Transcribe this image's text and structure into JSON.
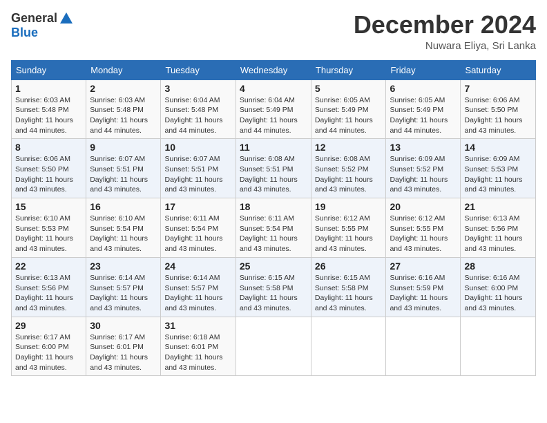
{
  "header": {
    "logo_general": "General",
    "logo_blue": "Blue",
    "month": "December 2024",
    "location": "Nuwara Eliya, Sri Lanka"
  },
  "calendar": {
    "columns": [
      "Sunday",
      "Monday",
      "Tuesday",
      "Wednesday",
      "Thursday",
      "Friday",
      "Saturday"
    ],
    "weeks": [
      [
        {
          "day": "",
          "sunrise": "",
          "sunset": "",
          "daylight": ""
        },
        {
          "day": "2",
          "sunrise": "Sunrise: 6:03 AM",
          "sunset": "Sunset: 5:48 PM",
          "daylight": "Daylight: 11 hours and 44 minutes."
        },
        {
          "day": "3",
          "sunrise": "Sunrise: 6:04 AM",
          "sunset": "Sunset: 5:48 PM",
          "daylight": "Daylight: 11 hours and 44 minutes."
        },
        {
          "day": "4",
          "sunrise": "Sunrise: 6:04 AM",
          "sunset": "Sunset: 5:49 PM",
          "daylight": "Daylight: 11 hours and 44 minutes."
        },
        {
          "day": "5",
          "sunrise": "Sunrise: 6:05 AM",
          "sunset": "Sunset: 5:49 PM",
          "daylight": "Daylight: 11 hours and 44 minutes."
        },
        {
          "day": "6",
          "sunrise": "Sunrise: 6:05 AM",
          "sunset": "Sunset: 5:49 PM",
          "daylight": "Daylight: 11 hours and 44 minutes."
        },
        {
          "day": "7",
          "sunrise": "Sunrise: 6:06 AM",
          "sunset": "Sunset: 5:50 PM",
          "daylight": "Daylight: 11 hours and 43 minutes."
        }
      ],
      [
        {
          "day": "8",
          "sunrise": "Sunrise: 6:06 AM",
          "sunset": "Sunset: 5:50 PM",
          "daylight": "Daylight: 11 hours and 43 minutes."
        },
        {
          "day": "9",
          "sunrise": "Sunrise: 6:07 AM",
          "sunset": "Sunset: 5:51 PM",
          "daylight": "Daylight: 11 hours and 43 minutes."
        },
        {
          "day": "10",
          "sunrise": "Sunrise: 6:07 AM",
          "sunset": "Sunset: 5:51 PM",
          "daylight": "Daylight: 11 hours and 43 minutes."
        },
        {
          "day": "11",
          "sunrise": "Sunrise: 6:08 AM",
          "sunset": "Sunset: 5:51 PM",
          "daylight": "Daylight: 11 hours and 43 minutes."
        },
        {
          "day": "12",
          "sunrise": "Sunrise: 6:08 AM",
          "sunset": "Sunset: 5:52 PM",
          "daylight": "Daylight: 11 hours and 43 minutes."
        },
        {
          "day": "13",
          "sunrise": "Sunrise: 6:09 AM",
          "sunset": "Sunset: 5:52 PM",
          "daylight": "Daylight: 11 hours and 43 minutes."
        },
        {
          "day": "14",
          "sunrise": "Sunrise: 6:09 AM",
          "sunset": "Sunset: 5:53 PM",
          "daylight": "Daylight: 11 hours and 43 minutes."
        }
      ],
      [
        {
          "day": "15",
          "sunrise": "Sunrise: 6:10 AM",
          "sunset": "Sunset: 5:53 PM",
          "daylight": "Daylight: 11 hours and 43 minutes."
        },
        {
          "day": "16",
          "sunrise": "Sunrise: 6:10 AM",
          "sunset": "Sunset: 5:54 PM",
          "daylight": "Daylight: 11 hours and 43 minutes."
        },
        {
          "day": "17",
          "sunrise": "Sunrise: 6:11 AM",
          "sunset": "Sunset: 5:54 PM",
          "daylight": "Daylight: 11 hours and 43 minutes."
        },
        {
          "day": "18",
          "sunrise": "Sunrise: 6:11 AM",
          "sunset": "Sunset: 5:54 PM",
          "daylight": "Daylight: 11 hours and 43 minutes."
        },
        {
          "day": "19",
          "sunrise": "Sunrise: 6:12 AM",
          "sunset": "Sunset: 5:55 PM",
          "daylight": "Daylight: 11 hours and 43 minutes."
        },
        {
          "day": "20",
          "sunrise": "Sunrise: 6:12 AM",
          "sunset": "Sunset: 5:55 PM",
          "daylight": "Daylight: 11 hours and 43 minutes."
        },
        {
          "day": "21",
          "sunrise": "Sunrise: 6:13 AM",
          "sunset": "Sunset: 5:56 PM",
          "daylight": "Daylight: 11 hours and 43 minutes."
        }
      ],
      [
        {
          "day": "22",
          "sunrise": "Sunrise: 6:13 AM",
          "sunset": "Sunset: 5:56 PM",
          "daylight": "Daylight: 11 hours and 43 minutes."
        },
        {
          "day": "23",
          "sunrise": "Sunrise: 6:14 AM",
          "sunset": "Sunset: 5:57 PM",
          "daylight": "Daylight: 11 hours and 43 minutes."
        },
        {
          "day": "24",
          "sunrise": "Sunrise: 6:14 AM",
          "sunset": "Sunset: 5:57 PM",
          "daylight": "Daylight: 11 hours and 43 minutes."
        },
        {
          "day": "25",
          "sunrise": "Sunrise: 6:15 AM",
          "sunset": "Sunset: 5:58 PM",
          "daylight": "Daylight: 11 hours and 43 minutes."
        },
        {
          "day": "26",
          "sunrise": "Sunrise: 6:15 AM",
          "sunset": "Sunset: 5:58 PM",
          "daylight": "Daylight: 11 hours and 43 minutes."
        },
        {
          "day": "27",
          "sunrise": "Sunrise: 6:16 AM",
          "sunset": "Sunset: 5:59 PM",
          "daylight": "Daylight: 11 hours and 43 minutes."
        },
        {
          "day": "28",
          "sunrise": "Sunrise: 6:16 AM",
          "sunset": "Sunset: 6:00 PM",
          "daylight": "Daylight: 11 hours and 43 minutes."
        }
      ],
      [
        {
          "day": "29",
          "sunrise": "Sunrise: 6:17 AM",
          "sunset": "Sunset: 6:00 PM",
          "daylight": "Daylight: 11 hours and 43 minutes."
        },
        {
          "day": "30",
          "sunrise": "Sunrise: 6:17 AM",
          "sunset": "Sunset: 6:01 PM",
          "daylight": "Daylight: 11 hours and 43 minutes."
        },
        {
          "day": "31",
          "sunrise": "Sunrise: 6:18 AM",
          "sunset": "Sunset: 6:01 PM",
          "daylight": "Daylight: 11 hours and 43 minutes."
        },
        {
          "day": "",
          "sunrise": "",
          "sunset": "",
          "daylight": ""
        },
        {
          "day": "",
          "sunrise": "",
          "sunset": "",
          "daylight": ""
        },
        {
          "day": "",
          "sunrise": "",
          "sunset": "",
          "daylight": ""
        },
        {
          "day": "",
          "sunrise": "",
          "sunset": "",
          "daylight": ""
        }
      ]
    ],
    "week0_day1": {
      "day": "1",
      "sunrise": "Sunrise: 6:03 AM",
      "sunset": "Sunset: 5:48 PM",
      "daylight": "Daylight: 11 hours and 44 minutes."
    }
  }
}
